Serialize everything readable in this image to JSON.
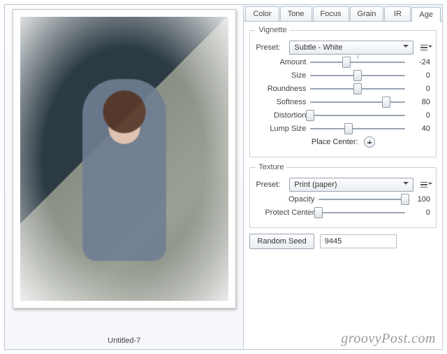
{
  "image_title": "Untitled-7",
  "watermark": "groovyPost.com",
  "tabs": [
    "Color",
    "Tone",
    "Focus",
    "Grain",
    "IR",
    "Age"
  ],
  "active_tab": "Age",
  "vignette": {
    "legend": "Vignette",
    "preset_label": "Preset:",
    "preset_value": "Subtle - White",
    "sliders": {
      "amount": {
        "label": "Amount",
        "value": -24,
        "min": -100,
        "max": 100,
        "center_tick": true
      },
      "size": {
        "label": "Size",
        "value": 0,
        "min": -100,
        "max": 100
      },
      "roundness": {
        "label": "Roundness",
        "value": 0,
        "min": -100,
        "max": 100
      },
      "softness": {
        "label": "Softness",
        "value": 80,
        "min": 0,
        "max": 100
      },
      "distortion": {
        "label": "Distortion",
        "value": 0,
        "min": 0,
        "max": 100
      },
      "lumpsize": {
        "label": "Lump Size",
        "value": 40,
        "min": 0,
        "max": 100
      }
    },
    "place_center_label": "Place Center:"
  },
  "texture": {
    "legend": "Texture",
    "preset_label": "Preset:",
    "preset_value": "Print (paper)",
    "sliders": {
      "opacity": {
        "label": "Opacity",
        "value": 100,
        "min": 0,
        "max": 100
      },
      "protect_center": {
        "label": "Protect Center",
        "value": 0,
        "min": 0,
        "max": 100
      }
    }
  },
  "random_seed": {
    "label": "Random Seed",
    "value": "9445"
  }
}
